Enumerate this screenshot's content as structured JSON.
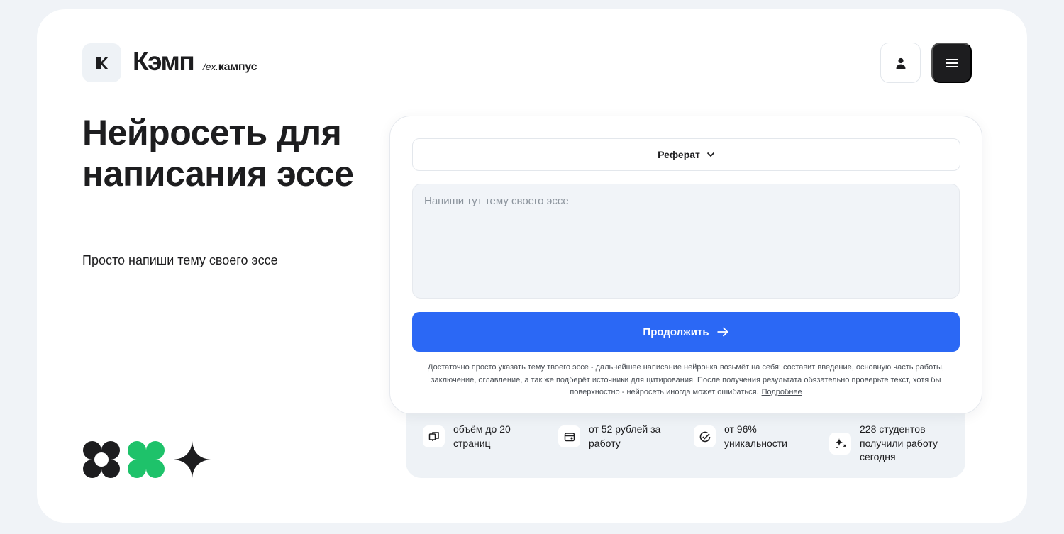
{
  "brand": {
    "name": "Кэмп",
    "sub_prefix": "/ex.",
    "sub_name": "кампус"
  },
  "header": {
    "profile_icon": "user-icon",
    "menu_icon": "hamburger-menu-icon"
  },
  "hero": {
    "title": "Нейросеть для написания эссе",
    "subtitle": "Просто напиши тему своего эссе"
  },
  "form": {
    "work_type": "Реферат",
    "topic_placeholder": "Напиши тут тему своего эссе",
    "topic_value": "",
    "continue_label": "Продолжить",
    "disclaimer": "Достаточно просто указать тему твоего эссе - дальнейшее написание нейронка возьмёт на себя: составит введение, основную часть работы, заключение, оглавление, а так же подберёт источники для цитирования. После получения результата обязательно проверьте текст, хотя бы поверхностно - нейросеть иногда может ошибаться.",
    "more_link": "Подробнее"
  },
  "stats": [
    {
      "icon": "pages-icon",
      "text": "объём до 20 страниц"
    },
    {
      "icon": "wallet-icon",
      "text": "от 52 рублей за работу"
    },
    {
      "icon": "check-circle-icon",
      "text": "от 96% уникальности"
    },
    {
      "icon": "sparkles-icon",
      "text": "228 студентов получили работу сегодня"
    }
  ],
  "colors": {
    "accent": "#2b68f5",
    "brand_green": "#1ec26a",
    "dark": "#1d1d1f",
    "background": "#f0f3f7"
  }
}
